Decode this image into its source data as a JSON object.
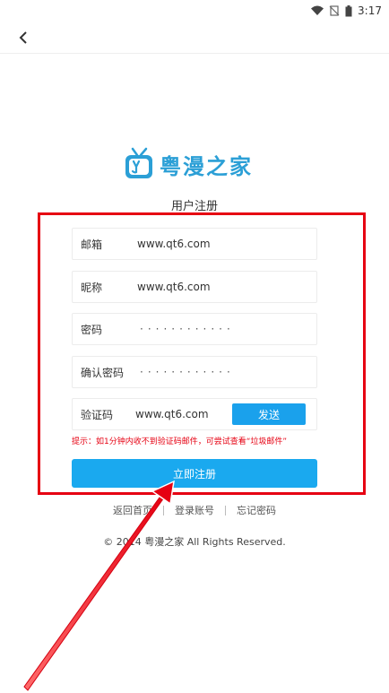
{
  "status_bar": {
    "time": "3:17"
  },
  "logo": {
    "text": "粤漫之家"
  },
  "page_title": "用户注册",
  "form": {
    "email": {
      "label": "邮箱",
      "value": "www.qt6.com"
    },
    "nickname": {
      "label": "昵称",
      "value": "www.qt6.com"
    },
    "password": {
      "label": "密码",
      "value": "············"
    },
    "confirm": {
      "label": "确认密码",
      "value": "············"
    },
    "captcha": {
      "label": "验证码",
      "value": "www.qt6.com",
      "send_label": "发送"
    }
  },
  "hint": "提示：如1分钟内收不到验证码邮件，可尝试查看“垃圾邮件”",
  "submit_label": "立即注册",
  "links": [
    "返回首页",
    "登录账号",
    "忘记密码"
  ],
  "copyright": "© 2014 粤漫之家 All Rights Reserved.",
  "colors": {
    "accent": "#1aa9ef",
    "highlight": "#e60012",
    "logo": "#2b9fd6"
  }
}
